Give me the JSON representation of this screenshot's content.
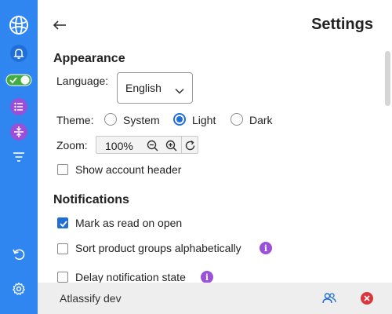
{
  "page": {
    "title": "Settings"
  },
  "sidebar": {
    "items": [
      {
        "icon": "globe-icon"
      },
      {
        "icon": "bell-icon"
      },
      {
        "icon": "toggle-icon"
      },
      {
        "icon": "list-icon"
      },
      {
        "icon": "collapse-icon"
      },
      {
        "icon": "filter-icon"
      },
      {
        "icon": "undo-icon"
      },
      {
        "icon": "gear-icon"
      }
    ],
    "color": "#2f86f0"
  },
  "appearance": {
    "title": "Appearance",
    "language_label": "Language:",
    "language_value": "English",
    "theme_label": "Theme:",
    "theme_options": [
      "System",
      "Light",
      "Dark"
    ],
    "theme_selected": "Light",
    "zoom_label": "Zoom:",
    "zoom_value": "100%",
    "show_account_header_label": "Show account header",
    "show_account_header_checked": false
  },
  "notifications": {
    "title": "Notifications",
    "items": [
      {
        "label": "Mark as read on open",
        "checked": true,
        "info": false
      },
      {
        "label": "Sort product groups alphabetically",
        "checked": false,
        "info": true
      },
      {
        "label": "Delay notification state",
        "checked": false,
        "info": true
      }
    ]
  },
  "footer": {
    "name": "Atlassify dev",
    "accounts_icon": "users-icon",
    "close_icon": "close-circle-icon"
  },
  "colors": {
    "accent": "#1f6fd6",
    "info": "#9c4fd8",
    "danger": "#d9363e",
    "toggle": "#3fae3f"
  }
}
